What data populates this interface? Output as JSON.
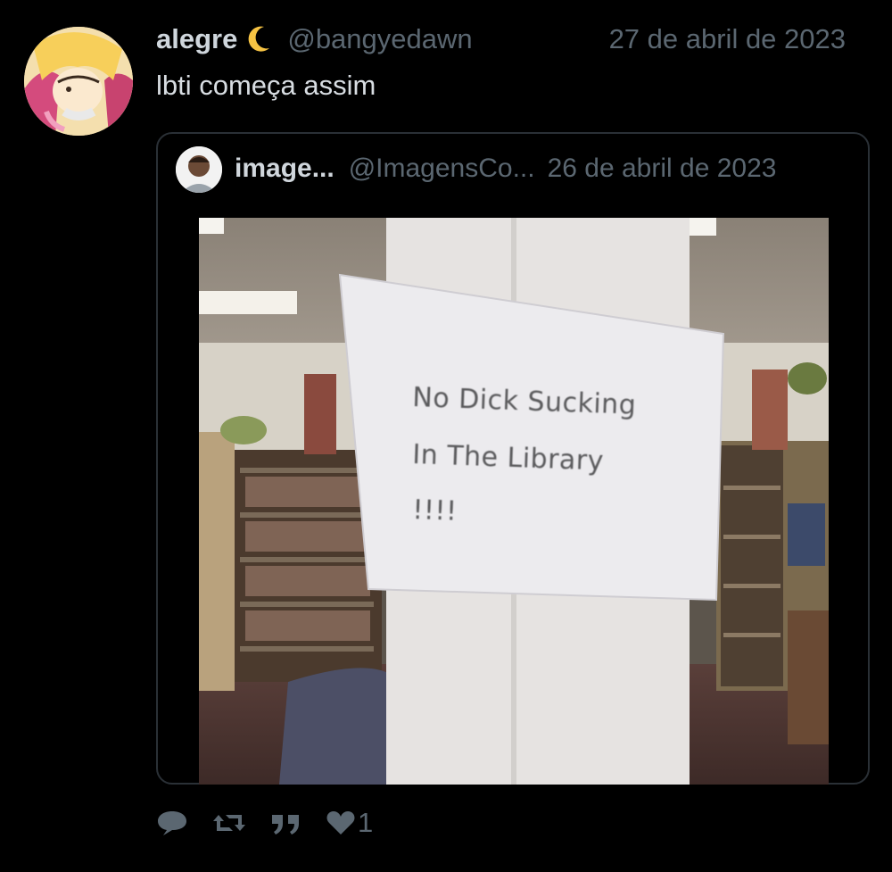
{
  "tweet": {
    "display_name": "alegre",
    "name_emoji": "crescent-moon",
    "handle": "@bangyedawn",
    "date": "27 de abril de 2023",
    "text": "lbti começa assim"
  },
  "quoted": {
    "display_name": "image...",
    "handle": "@ImagensCo...",
    "date": "26 de abril de 2023",
    "image": {
      "sign_lines": [
        "No Dick Sucking",
        "In The Library",
        "!!!!"
      ]
    }
  },
  "actions": {
    "reply_icon": "reply-icon",
    "retweet_icon": "retweet-icon",
    "quote_icon": "quote-icon",
    "like_icon": "heart-icon",
    "like_count": "1"
  },
  "colors": {
    "background": "#000000",
    "text_primary": "#d8dde2",
    "text_secondary": "#5b6771",
    "border": "#2a3036",
    "moon": "#f6c343"
  }
}
